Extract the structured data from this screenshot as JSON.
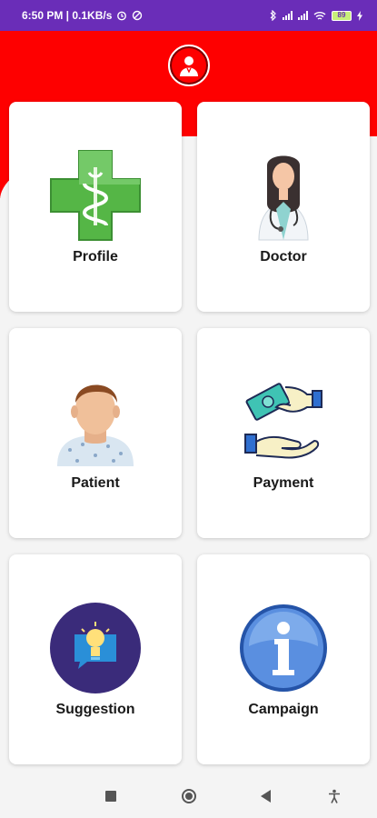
{
  "status": {
    "time_net": "6:50 PM | 0.1KB/s",
    "battery": "89"
  },
  "menu": [
    {
      "label": "Profile",
      "icon": "pharmacy-cross-icon"
    },
    {
      "label": "Doctor",
      "icon": "doctor-icon"
    },
    {
      "label": "Patient",
      "icon": "patient-icon"
    },
    {
      "label": "Payment",
      "icon": "payment-icon"
    },
    {
      "label": "Suggestion",
      "icon": "lightbulb-icon"
    },
    {
      "label": "Campaign",
      "icon": "info-icon"
    }
  ],
  "colors": {
    "header": "#fe0000",
    "status_bar": "#6a2db8",
    "card": "#ffffff"
  },
  "nav": {
    "icons": [
      "recent-apps-icon",
      "home-icon",
      "back-icon",
      "accessibility-icon"
    ]
  }
}
